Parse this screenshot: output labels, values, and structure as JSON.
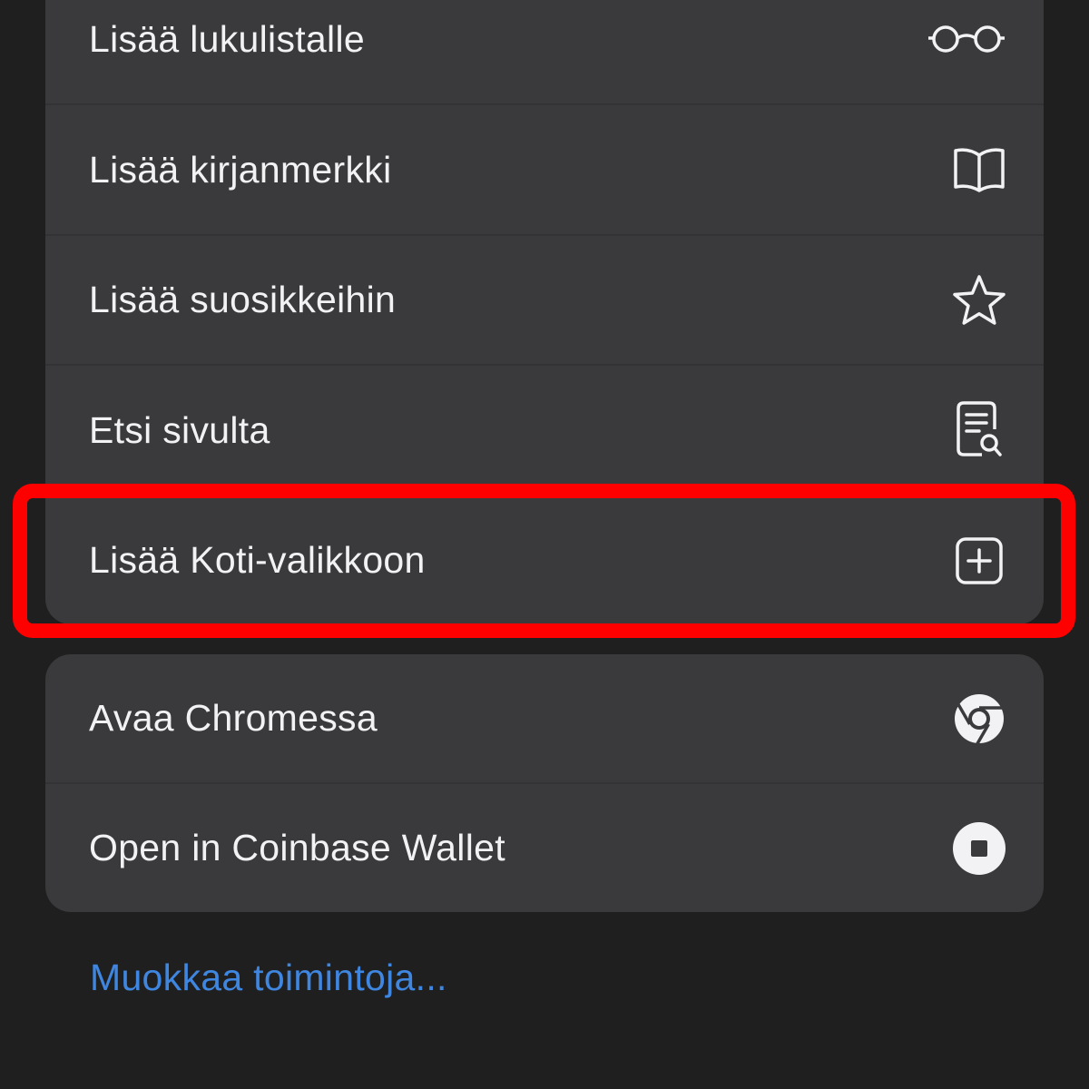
{
  "menu": {
    "group1": [
      {
        "label": "Lisää lukulistalle",
        "icon": "glasses-icon"
      },
      {
        "label": "Lisää kirjanmerkki",
        "icon": "book-icon"
      },
      {
        "label": "Lisää suosikkeihin",
        "icon": "star-icon"
      },
      {
        "label": "Etsi sivulta",
        "icon": "find-document-icon"
      },
      {
        "label": "Lisää Koti-valikkoon",
        "icon": "add-square-icon"
      }
    ],
    "group2": [
      {
        "label": "Avaa Chromessa",
        "icon": "chrome-icon"
      },
      {
        "label": "Open in Coinbase Wallet",
        "icon": "coinbase-icon"
      }
    ],
    "edit_actions_label": "Muokkaa toimintoja..."
  },
  "colors": {
    "background": "#1f1f20",
    "group_background": "#3a3a3c",
    "text": "#f2f2f4",
    "link": "#3f86e0",
    "highlight": "#ff0000"
  }
}
